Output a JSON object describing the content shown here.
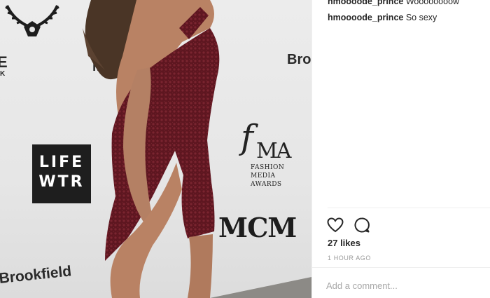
{
  "photo": {
    "backdrop": {
      "fragment_top_left": "E",
      "fragment_top_left_small": "K",
      "fragment_mid": "M",
      "brookfield_top": "Broo",
      "brookfield_bottom": "Brookfield"
    },
    "lifewtr": {
      "line1": "LIFE",
      "line2": "WTR"
    },
    "fma": {
      "mark": "f",
      "mark2": "MA",
      "line1": "FASHION",
      "line2": "MEDIA",
      "line3": "AWARDS"
    },
    "mcm": "MCM"
  },
  "comments": [
    {
      "user": "hmoooode_prince",
      "text": "Woooooooow"
    },
    {
      "user": "hmoooode_prince",
      "text": "So sexy"
    }
  ],
  "actions": {
    "like_icon": "heart-icon",
    "comment_icon": "speech-bubble-icon"
  },
  "likes": "27 likes",
  "time": "1 HOUR AGO",
  "add_comment": {
    "placeholder": "Add a comment..."
  },
  "colors": {
    "dress": "#5e1620",
    "skin": "#b98264",
    "hair": "#4a3526",
    "panel_border": "#efefef",
    "muted_text": "#999999"
  }
}
